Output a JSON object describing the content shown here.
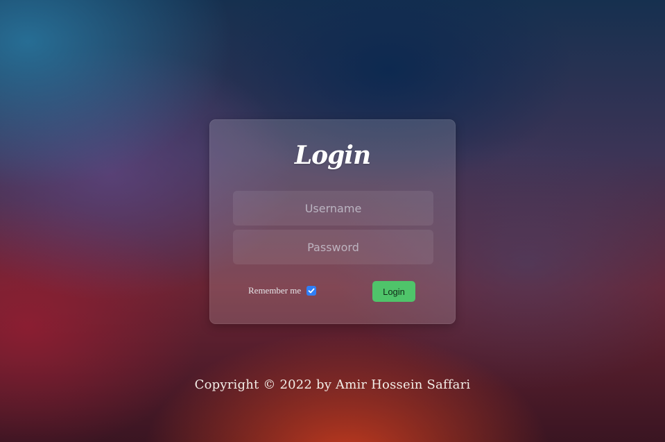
{
  "login_card": {
    "title": "Login",
    "username": {
      "placeholder": "Username",
      "value": ""
    },
    "password": {
      "placeholder": "Password",
      "value": ""
    },
    "remember_me": {
      "label": "Remember me",
      "checked": true
    },
    "submit_label": "Login"
  },
  "footer": {
    "copyright": "Copyright © 2022 by Amir Hossein Saffari"
  },
  "colors": {
    "button": "#4fc46a",
    "checkbox": "#2f7ef5"
  }
}
